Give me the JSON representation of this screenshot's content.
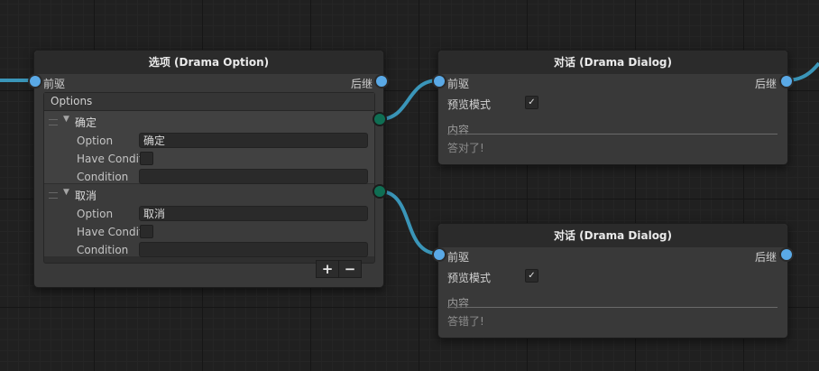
{
  "option_node": {
    "title": "选项 (Drama Option)",
    "in_port": "前驱",
    "out_port": "后继",
    "list_header": "Options",
    "items": [
      {
        "name": "确定",
        "option_label": "Option",
        "option_value": "确定",
        "have_condition_label": "Have Condit",
        "condition_label": "Condition",
        "condition_value": ""
      },
      {
        "name": "取消",
        "option_label": "Option",
        "option_value": "取消",
        "have_condition_label": "Have Condit",
        "condition_label": "Condition",
        "condition_value": ""
      }
    ],
    "add_label": "+",
    "remove_label": "−"
  },
  "dialog_nodes": [
    {
      "title": "对话 (Drama Dialog)",
      "in_port": "前驱",
      "out_port": "后继",
      "preview_label": "预览模式",
      "preview_checked": "✓",
      "content_label": "内容",
      "content_value": "答对了!"
    },
    {
      "title": "对话 (Drama Dialog)",
      "in_port": "前驱",
      "out_port": "后继",
      "preview_label": "预览模式",
      "preview_checked": "✓",
      "content_label": "内容",
      "content_value": "答错了!"
    }
  ],
  "colors": {
    "edge": "#3a95b8",
    "port_blue": "#5aa9e6",
    "port_green": "#0f6e53"
  }
}
